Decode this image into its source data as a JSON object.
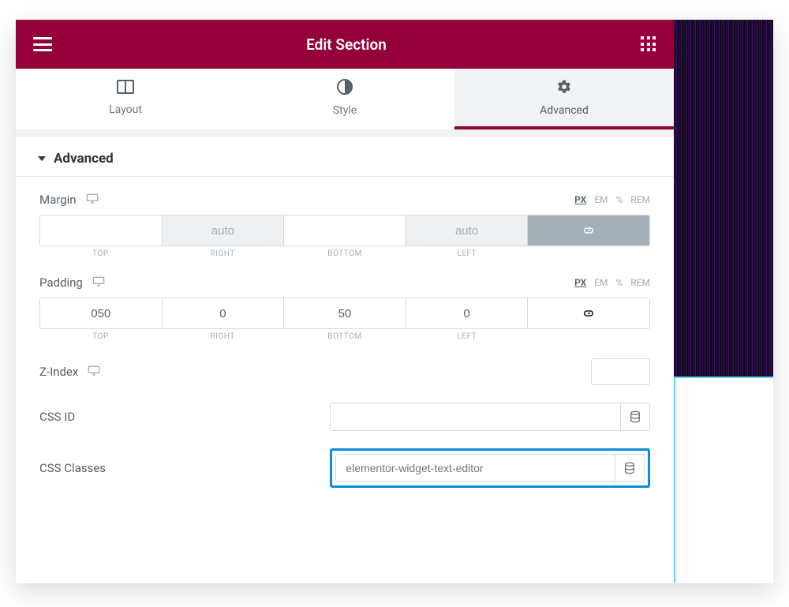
{
  "header": {
    "title": "Edit Section"
  },
  "tabs": {
    "layout": "Layout",
    "style": "Style",
    "advanced": "Advanced"
  },
  "section": {
    "title": "Advanced"
  },
  "units": {
    "px": "PX",
    "em": "EM",
    "pct": "%",
    "rem": "REM"
  },
  "margin": {
    "label": "Margin",
    "top": "",
    "right": "auto",
    "bottom": "",
    "left": "auto",
    "sub": {
      "top": "TOP",
      "right": "RIGHT",
      "bottom": "BOTTOM",
      "left": "LEFT"
    }
  },
  "padding": {
    "label": "Padding",
    "top": "050",
    "right": "0",
    "bottom": "50",
    "left": "0",
    "sub": {
      "top": "TOP",
      "right": "RIGHT",
      "bottom": "BOTTOM",
      "left": "LEFT"
    }
  },
  "zindex": {
    "label": "Z-Index",
    "value": ""
  },
  "cssid": {
    "label": "CSS ID",
    "value": ""
  },
  "cssclasses": {
    "label": "CSS Classes",
    "value": "elementor-widget-text-editor"
  }
}
